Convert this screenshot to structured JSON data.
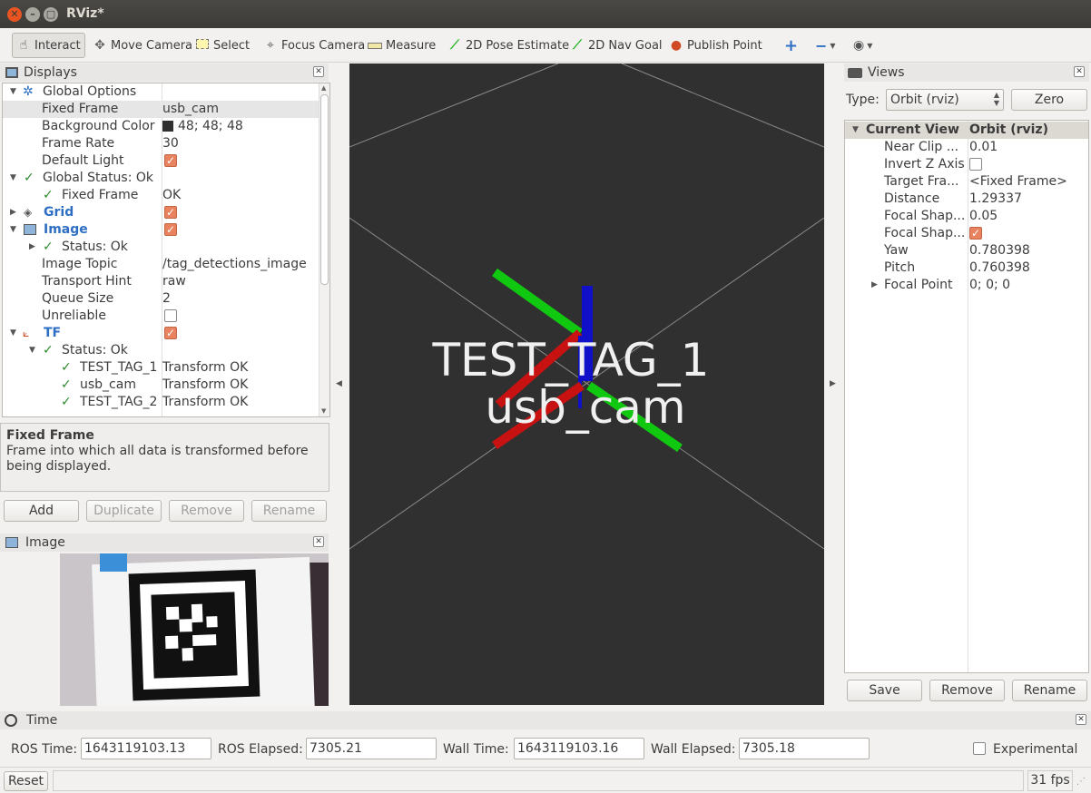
{
  "window": {
    "title": "RViz*"
  },
  "toolbar": {
    "interact": "Interact",
    "move_camera": "Move Camera",
    "select": "Select",
    "focus_camera": "Focus Camera",
    "measure": "Measure",
    "pose_estimate": "2D Pose Estimate",
    "nav_goal": "2D Nav Goal",
    "publish_point": "Publish Point"
  },
  "displays": {
    "title": "Displays",
    "rows": {
      "global_options": "Global Options",
      "fixed_frame_label": "Fixed Frame",
      "fixed_frame_value": "usb_cam",
      "bg_color_label": "Background Color",
      "bg_color_value": "48; 48; 48",
      "frame_rate_label": "Frame Rate",
      "frame_rate_value": "30",
      "default_light_label": "Default Light",
      "global_status": "Global Status: Ok",
      "gs_fixed_frame": "Fixed Frame",
      "gs_fixed_frame_value": "OK",
      "grid": "Grid",
      "image": "Image",
      "image_status": "Status: Ok",
      "image_topic_label": "Image Topic",
      "image_topic_value": "/tag_detections_image",
      "transport_label": "Transport Hint",
      "transport_value": "raw",
      "queue_label": "Queue Size",
      "queue_value": "2",
      "unreliable_label": "Unreliable",
      "tf": "TF",
      "tf_status": "Status: Ok",
      "tag1": "TEST_TAG_1",
      "tag1_value": "Transform OK",
      "usb_cam": "usb_cam",
      "usb_cam_value": "Transform OK",
      "tag2": "TEST_TAG_2",
      "tag2_value": "Transform OK"
    },
    "help_title": "Fixed Frame",
    "help_text": "Frame into which all data is transformed before being displayed.",
    "buttons": {
      "add": "Add",
      "duplicate": "Duplicate",
      "remove": "Remove",
      "rename": "Rename"
    }
  },
  "image_panel": {
    "title": "Image"
  },
  "viewport": {
    "label1": "TEST_TAG_1",
    "label2": "usb_cam"
  },
  "views": {
    "title": "Views",
    "type_label": "Type:",
    "type_value": "Orbit (rviz)",
    "zero": "Zero",
    "current_view": "Current View",
    "current_view_value": "Orbit (rviz)",
    "props": [
      {
        "k": "Near Clip ...",
        "v": "0.01"
      },
      {
        "k": "Invert Z Axis",
        "v": ""
      },
      {
        "k": "Target Fra...",
        "v": "<Fixed Frame>"
      },
      {
        "k": "Distance",
        "v": "1.29337"
      },
      {
        "k": "Focal Shap...",
        "v": "0.05"
      },
      {
        "k": "Focal Shap...",
        "v": ""
      },
      {
        "k": "Yaw",
        "v": "0.780398"
      },
      {
        "k": "Pitch",
        "v": "0.760398"
      },
      {
        "k": "Focal Point",
        "v": "0; 0; 0"
      }
    ],
    "buttons": {
      "save": "Save",
      "remove": "Remove",
      "rename": "Rename"
    }
  },
  "time": {
    "title": "Time",
    "ros_time_label": "ROS Time:",
    "ros_time": "1643119103.13",
    "ros_elapsed_label": "ROS Elapsed:",
    "ros_elapsed": "7305.21",
    "wall_time_label": "Wall Time:",
    "wall_time": "1643119103.16",
    "wall_elapsed_label": "Wall Elapsed:",
    "wall_elapsed": "7305.18",
    "experimental": "Experimental"
  },
  "status": {
    "reset": "Reset",
    "fps": "31 fps"
  },
  "colors": {
    "viewport_bg": "#303030",
    "accent": "#e9825e",
    "x_axis": "#cc1111",
    "y_axis": "#11cc11",
    "z_axis": "#1111cc"
  }
}
